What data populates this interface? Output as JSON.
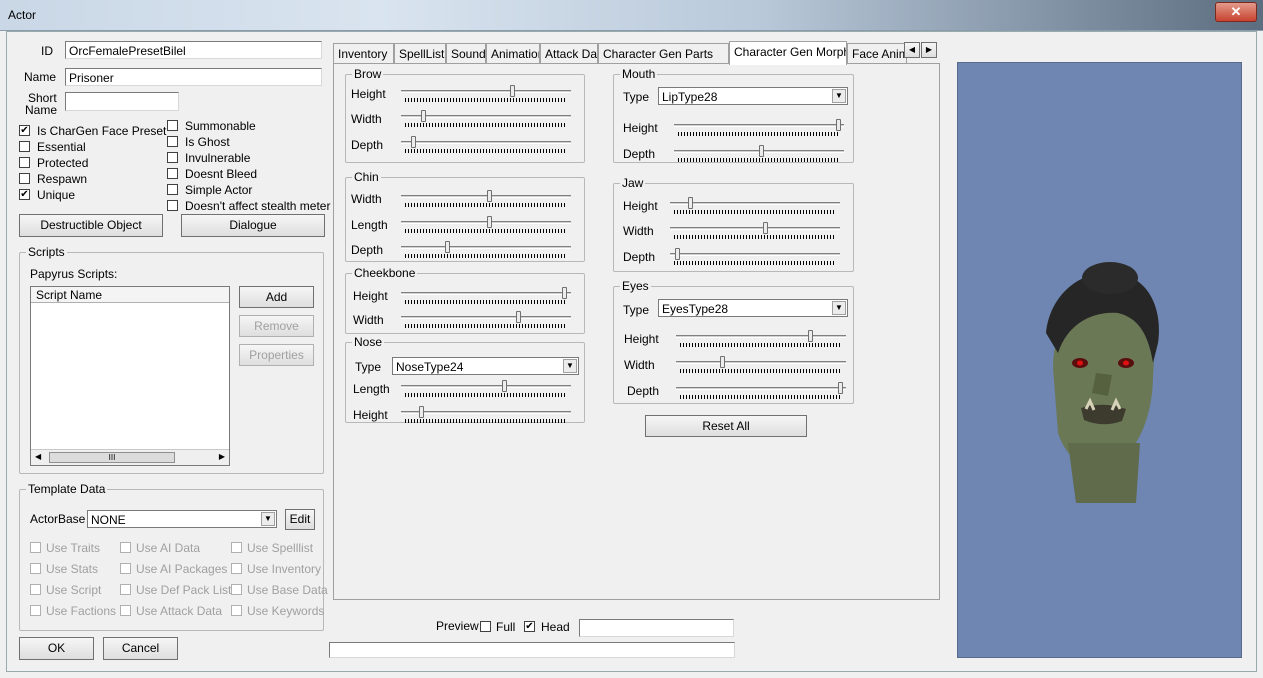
{
  "window": {
    "title": "Actor",
    "close": "✕"
  },
  "general": {
    "id_label": "ID",
    "id_value": "OrcFemalePresetBilel",
    "name_label": "Name",
    "name_value": "Prisoner",
    "short_label_1": "Short",
    "short_label_2": "Name",
    "short_value": ""
  },
  "flags_left": [
    {
      "label": "Is CharGen Face Preset",
      "checked": true
    },
    {
      "label": "Essential",
      "checked": false
    },
    {
      "label": "Protected",
      "checked": false
    },
    {
      "label": "Respawn",
      "checked": false
    },
    {
      "label": "Unique",
      "checked": true
    }
  ],
  "flags_right": [
    {
      "label": "Summonable",
      "checked": false
    },
    {
      "label": "Is Ghost",
      "checked": false
    },
    {
      "label": "Invulnerable",
      "checked": false
    },
    {
      "label": "Doesnt Bleed",
      "checked": false
    },
    {
      "label": "Simple Actor",
      "checked": false
    },
    {
      "label": "Doesn't affect stealth meter",
      "checked": false
    }
  ],
  "buttons": {
    "destructible": "Destructible Object",
    "dialogue": "Dialogue",
    "ok": "OK",
    "cancel": "Cancel"
  },
  "scripts": {
    "group": "Scripts",
    "sub": "Papyrus Scripts:",
    "column": "Script Name",
    "add": "Add",
    "remove": "Remove",
    "properties": "Properties",
    "scroll_grip": "III"
  },
  "template": {
    "group": "Template Data",
    "actorbase_label": "ActorBase",
    "actorbase_value": "NONE",
    "edit": "Edit",
    "col1": [
      "Use Traits",
      "Use Stats",
      "Use Script",
      "Use Factions"
    ],
    "col2": [
      "Use AI Data",
      "Use AI Packages",
      "Use Def Pack List",
      "Use Attack Data"
    ],
    "col3": [
      "Use Spelllist",
      "Use Inventory",
      "Use Base Data",
      "Use Keywords"
    ]
  },
  "tabs": [
    "Inventory",
    "SpellList",
    "Sounds",
    "Animation",
    "Attack Data",
    "Character Gen Parts",
    "Character Gen Morphs",
    "Face Anim F"
  ],
  "selected_tab": "Character Gen Morphs",
  "morphs": {
    "brow": {
      "title": "Brow",
      "height": "Height",
      "width": "Width",
      "depth": "Depth"
    },
    "chin": {
      "title": "Chin",
      "width": "Width",
      "length": "Length",
      "depth": "Depth"
    },
    "cheekbone": {
      "title": "Cheekbone",
      "height": "Height",
      "width": "Width"
    },
    "nose": {
      "title": "Nose",
      "type_label": "Type",
      "type_value": "NoseType24",
      "length": "Length",
      "height": "Height"
    },
    "mouth": {
      "title": "Mouth",
      "type_label": "Type",
      "type_value": "LipType28",
      "height": "Height",
      "depth": "Depth"
    },
    "jaw": {
      "title": "Jaw",
      "height": "Height",
      "width": "Width",
      "depth": "Depth"
    },
    "eyes": {
      "title": "Eyes",
      "type_label": "Type",
      "type_value": "EyesType28",
      "height": "Height",
      "width": "Width",
      "depth": "Depth"
    },
    "reset": "Reset All"
  },
  "slider_values": {
    "brow": [
      0.66,
      0.11,
      0.05
    ],
    "chin": [
      0.52,
      0.52,
      0.26
    ],
    "cheekbone": [
      0.98,
      0.7
    ],
    "nose": [
      0.61,
      0.1
    ],
    "mouth": [
      0.99,
      0.51
    ],
    "jaw": [
      0.1,
      0.56,
      0.02
    ],
    "eyes": [
      0.8,
      0.26,
      0.99
    ]
  },
  "preview": {
    "label": "Preview",
    "full": "Full",
    "full_checked": false,
    "head": "Head",
    "head_checked": true
  },
  "colors": {
    "preview_bg": "#6f86b3",
    "skin": "#6f7d5c",
    "hair": "#2a2a2a"
  }
}
